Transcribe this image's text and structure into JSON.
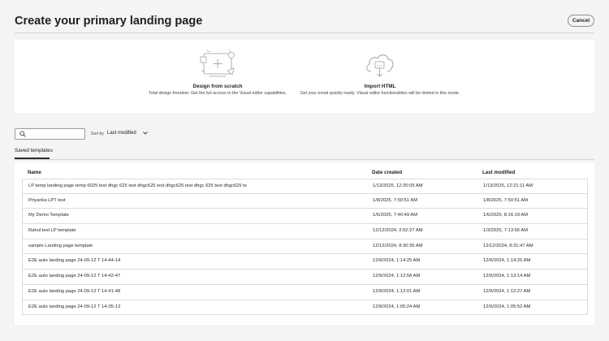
{
  "header": {
    "title": "Create your primary landing page",
    "cancel_label": "Cancel"
  },
  "options": [
    {
      "title": "Design from scratch",
      "description": "Total design freedom. Get the full access to the Visual editor capabilities.",
      "icon": "design-canvas-icon"
    },
    {
      "title": "Import HTML",
      "description": "Get your email quickly ready. Visual editor functionalities will be limited in this mode.",
      "icon": "cloud-import-icon"
    }
  ],
  "search": {
    "placeholder": "",
    "value": ""
  },
  "sort": {
    "label": "Sort by",
    "value": "Last modified"
  },
  "tabs": [
    {
      "label": "Saved templates",
      "selected": true
    }
  ],
  "table": {
    "columns": [
      "Name",
      "Date created",
      "Last modified"
    ],
    "rows": [
      {
        "name": "LP temp landing page temp 6025 test dhgc 625 test dhgc625 test dhgc625 test dhgc 625 test dhgc625 te",
        "created": "1/13/2025, 12:20:05 AM",
        "modified": "1/13/2025, 12:21:11 AM"
      },
      {
        "name": "Priyanka LPT test",
        "created": "1/8/2025, 7:50:51 AM",
        "modified": "1/8/2025, 7:50:51 AM"
      },
      {
        "name": "My Demo Template",
        "created": "1/6/2025, 7:40:49 AM",
        "modified": "1/6/2025, 8:16:19 AM"
      },
      {
        "name": "Rahul test LP template",
        "created": "12/12/2024, 2:52:27 AM",
        "modified": "1/3/2025, 7:13:56 AM"
      },
      {
        "name": "sample Landing page template",
        "created": "12/12/2024, 8:30:35 AM",
        "modified": "12/12/2024, 8:31:47 AM"
      },
      {
        "name": "E2E auto landing page 24-09-12 T 14-44-14",
        "created": "12/9/2024, 1:14:25 AM",
        "modified": "12/9/2024, 1:14:25 AM"
      },
      {
        "name": "E2E auto landing page 24-09-12 T 14-42-47",
        "created": "12/9/2024, 1:12:58 AM",
        "modified": "12/9/2024, 1:13:14 AM"
      },
      {
        "name": "E2E auto landing page 24-09-12 T 14-41-48",
        "created": "12/9/2024, 1:12:01 AM",
        "modified": "12/9/2024, 1:12:27 AM"
      },
      {
        "name": "E2E auto landing page 24-09-12 T 14-35-13",
        "created": "12/9/2024, 1:05:24 AM",
        "modified": "12/9/2024, 1:05:52 AM"
      }
    ]
  }
}
